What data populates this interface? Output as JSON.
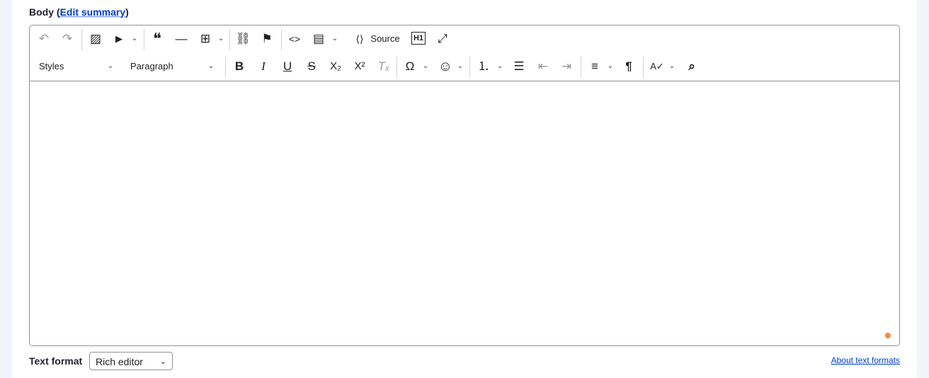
{
  "field_label": "Body",
  "edit_summary": "Edit summary",
  "toolbar_row1": [
    {
      "name": "undo",
      "glyph": "↶"
    },
    {
      "name": "redo",
      "glyph": "↷"
    },
    {
      "name": "insert-image",
      "glyph": "▨"
    },
    {
      "name": "insert-media",
      "glyph": "▶"
    },
    {
      "name": "block-quote",
      "glyph": "❝"
    },
    {
      "name": "horizontal-line",
      "glyph": "—"
    },
    {
      "name": "insert-table",
      "glyph": "⊞"
    },
    {
      "name": "link",
      "glyph": "⛓"
    },
    {
      "name": "anchor",
      "glyph": "⚑"
    },
    {
      "name": "code",
      "glyph": "<>"
    },
    {
      "name": "code-block",
      "glyph": "▤"
    },
    {
      "name": "source-icon",
      "glyph": "⟨⟩"
    },
    {
      "name": "heading-id",
      "glyph": "H1"
    },
    {
      "name": "fullscreen",
      "glyph": "⤢"
    }
  ],
  "source_label": "Source",
  "styles_label": "Styles",
  "paragraph_label": "Paragraph",
  "toolbar_row2": [
    {
      "name": "bold",
      "glyph": "B"
    },
    {
      "name": "italic",
      "glyph": "I"
    },
    {
      "name": "underline",
      "glyph": "U"
    },
    {
      "name": "strikethrough",
      "glyph": "S"
    },
    {
      "name": "subscript",
      "glyph": "X₂"
    },
    {
      "name": "superscript",
      "glyph": "X²"
    },
    {
      "name": "remove-format",
      "glyph": "Tₓ"
    },
    {
      "name": "special-characters",
      "glyph": "Ω"
    },
    {
      "name": "emoji",
      "glyph": "☺"
    },
    {
      "name": "numbered-list",
      "glyph": "⒈"
    },
    {
      "name": "bulleted-list",
      "glyph": "☰"
    },
    {
      "name": "outdent",
      "glyph": "⇤"
    },
    {
      "name": "indent",
      "glyph": "⇥"
    },
    {
      "name": "text-alignment",
      "glyph": "≡"
    },
    {
      "name": "text-direction",
      "glyph": "¶"
    },
    {
      "name": "spellcheck",
      "glyph": "A✓"
    },
    {
      "name": "find-replace",
      "glyph": "⌕"
    }
  ],
  "chevron": "⌄",
  "text_format_label": "Text format",
  "text_format_value": "Rich editor",
  "about_text_formats": "About text formats",
  "status_dot_color": "#f98a3c"
}
